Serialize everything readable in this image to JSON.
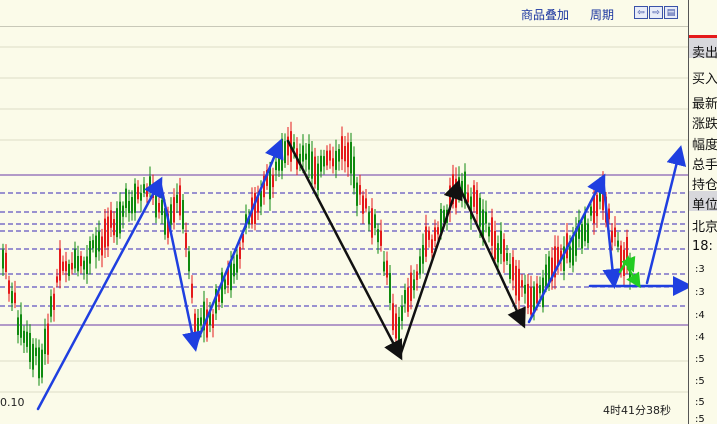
{
  "toolbar": {
    "overlay_label": "商品叠加",
    "period_label": "周期",
    "nav_prev": "⇦",
    "nav_next": "⇨",
    "nav_menu": "▤"
  },
  "chart": {
    "low_price_label": "0.10",
    "countdown": "4时41分38秒"
  },
  "side_panel": {
    "rows": [
      "卖出",
      "买入",
      "最新",
      "涨跌",
      "幅度",
      "总手",
      "持仓",
      "单位",
      "北京",
      "18:"
    ],
    "numbers": [
      ":3",
      ":3",
      ":4",
      ":4",
      ":5",
      ":5",
      ":5",
      ":5"
    ]
  },
  "colors": {
    "background": "#fbfbe9",
    "up_candle": "#e51a1a",
    "down_candle": "#0f8a0f",
    "dashed_line": "#3a2ab8",
    "solid_line": "#6a3aa8",
    "trend_blue": "#1f3fe0",
    "trend_black": "#111111",
    "accent_green": "#22cc22"
  }
}
